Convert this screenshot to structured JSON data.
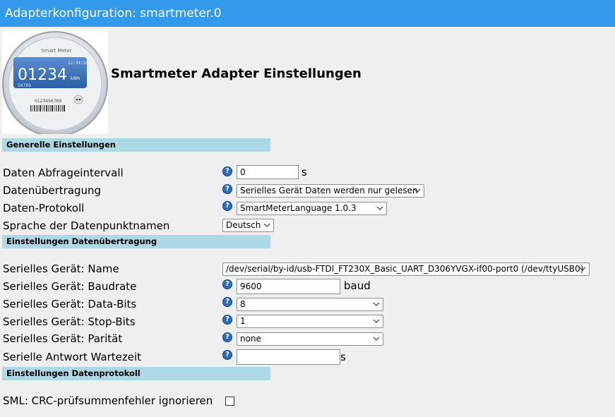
{
  "window": {
    "title": "Adapterkonfiguration: smartmeter.0"
  },
  "logo": {
    "brand": "Smart Meter",
    "display_value": "01234",
    "display_unit": "kWh",
    "display_time": "12:34:56",
    "display_sub": "56789",
    "serial": "0123456789"
  },
  "page": {
    "heading": "Smartmeter Adapter Einstellungen"
  },
  "sections": {
    "general": "Generelle Einstellungen",
    "transfer": "Einstellungen Datenübertragung",
    "protocol": "Einstellungen Datenprotokoll"
  },
  "general": {
    "interval_label": "Daten Abfrageintervall",
    "interval_value": "0",
    "interval_unit": "s",
    "transfer_label": "Datenübertragung",
    "transfer_value": "Serielles Gerät Daten werden nur gelesen",
    "protocol_label": "Daten-Protokoll",
    "protocol_value": "SmartMeterLanguage 1.0.3",
    "language_label": "Sprache der Datenpunktnamen",
    "language_value": "Deutsch"
  },
  "transfer": {
    "name_label": "Serielles Gerät: Name",
    "name_value": "/dev/serial/by-id/usb-FTDI_FT230X_Basic_UART_D306YVGX-if00-port0 (/dev/ttyUSB0)",
    "baud_label": "Serielles Gerät: Baudrate",
    "baud_value": "9600",
    "baud_unit": "baud",
    "databits_label": "Serielles Gerät: Data-Bits",
    "databits_value": "8",
    "stopbits_label": "Serielles Gerät: Stop-Bits",
    "stopbits_value": "1",
    "parity_label": "Serielles Gerät: Parität",
    "parity_value": "none",
    "wait_label": "Serielle Antwort Wartezeit",
    "wait_value": "",
    "wait_unit": "s"
  },
  "protocol": {
    "crc_label": "SML: CRC-prüfsummenfehler ignorieren",
    "crc_checked": false
  },
  "help": {
    "glyph": "?"
  },
  "colors": {
    "titlebar": "#3399ea",
    "section": "#add8e6",
    "help": "#2f6db5",
    "background": "#efefef"
  }
}
